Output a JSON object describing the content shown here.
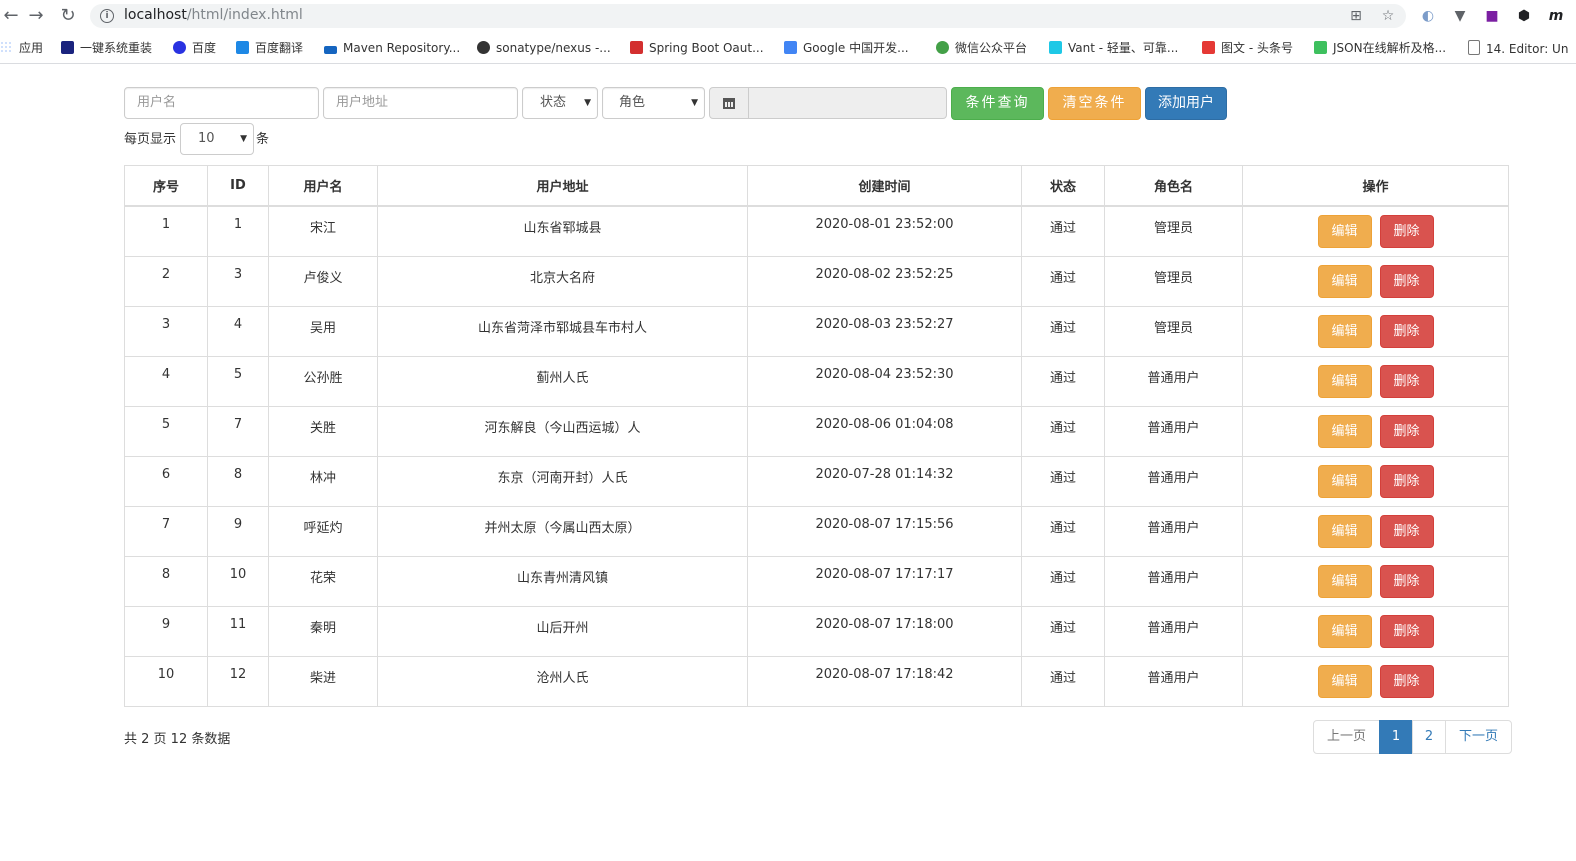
{
  "browser": {
    "url_host": "localhost",
    "url_path": "/html/index.html",
    "bookmarks": [
      {
        "label": "应用",
        "color": "#4285f4"
      },
      {
        "label": "一键系统重装",
        "color": "#1a237e"
      },
      {
        "label": "百度",
        "color": "#2932e1"
      },
      {
        "label": "百度翻译",
        "color": "#1e88e5"
      },
      {
        "label": "Maven Repository...",
        "color": "#1565c0"
      },
      {
        "label": "sonatype/nexus -...",
        "color": "#333333"
      },
      {
        "label": "Spring Boot Oaut...",
        "color": "#d32f2f"
      },
      {
        "label": "Google 中国开发...",
        "color": "#4285f4"
      },
      {
        "label": "微信公众平台",
        "color": "#43a047"
      },
      {
        "label": "Vant - 轻量、可靠...",
        "color": "#1ec8e6"
      },
      {
        "label": "图文 - 头条号",
        "color": "#e53935"
      },
      {
        "label": "JSON在线解析及格...",
        "color": "#3ec05e"
      },
      {
        "label": "14. Editor: Un",
        "color": "#777777"
      }
    ]
  },
  "search": {
    "username_placeholder": "用户名",
    "address_placeholder": "用户地址",
    "status_value": "状态",
    "role_value": "角色",
    "query_button": "条件查询",
    "clear_button": "清空条件",
    "add_button": "添加用户"
  },
  "pagesize": {
    "prefix": "每页显示",
    "value": "10",
    "suffix": "条"
  },
  "table": {
    "headers": [
      "序号",
      "ID",
      "用户名",
      "用户地址",
      "创建时间",
      "状态",
      "角色名",
      "操作"
    ],
    "edit_label": "编辑",
    "delete_label": "删除",
    "rows": [
      [
        "1",
        "1",
        "宋江",
        "山东省郓城县",
        "2020-08-01 23:52:00",
        "通过",
        "管理员"
      ],
      [
        "2",
        "3",
        "卢俊义",
        "北京大名府",
        "2020-08-02 23:52:25",
        "通过",
        "管理员"
      ],
      [
        "3",
        "4",
        "吴用",
        "山东省菏泽市郓城县车市村人",
        "2020-08-03 23:52:27",
        "通过",
        "管理员"
      ],
      [
        "4",
        "5",
        "公孙胜",
        "蓟州人氏",
        "2020-08-04 23:52:30",
        "通过",
        "普通用户"
      ],
      [
        "5",
        "7",
        "关胜",
        "河东解良（今山西运城）人",
        "2020-08-06 01:04:08",
        "通过",
        "普通用户"
      ],
      [
        "6",
        "8",
        "林冲",
        "东京（河南开封）人氏",
        "2020-07-28 01:14:32",
        "通过",
        "普通用户"
      ],
      [
        "7",
        "9",
        "呼延灼",
        "并州太原（今属山西太原）",
        "2020-08-07 17:15:56",
        "通过",
        "普通用户"
      ],
      [
        "8",
        "10",
        "花荣",
        "山东青州清风镇",
        "2020-08-07 17:17:17",
        "通过",
        "普通用户"
      ],
      [
        "9",
        "11",
        "秦明",
        "山后开州",
        "2020-08-07 17:18:00",
        "通过",
        "普通用户"
      ],
      [
        "10",
        "12",
        "柴进",
        "沧州人氏",
        "2020-08-07 17:18:42",
        "通过",
        "普通用户"
      ]
    ]
  },
  "footer": {
    "summary": "共 2 页 12 条数据",
    "prev": "上一页",
    "pages": [
      "1",
      "2"
    ],
    "current_page": "1",
    "next": "下一页"
  }
}
